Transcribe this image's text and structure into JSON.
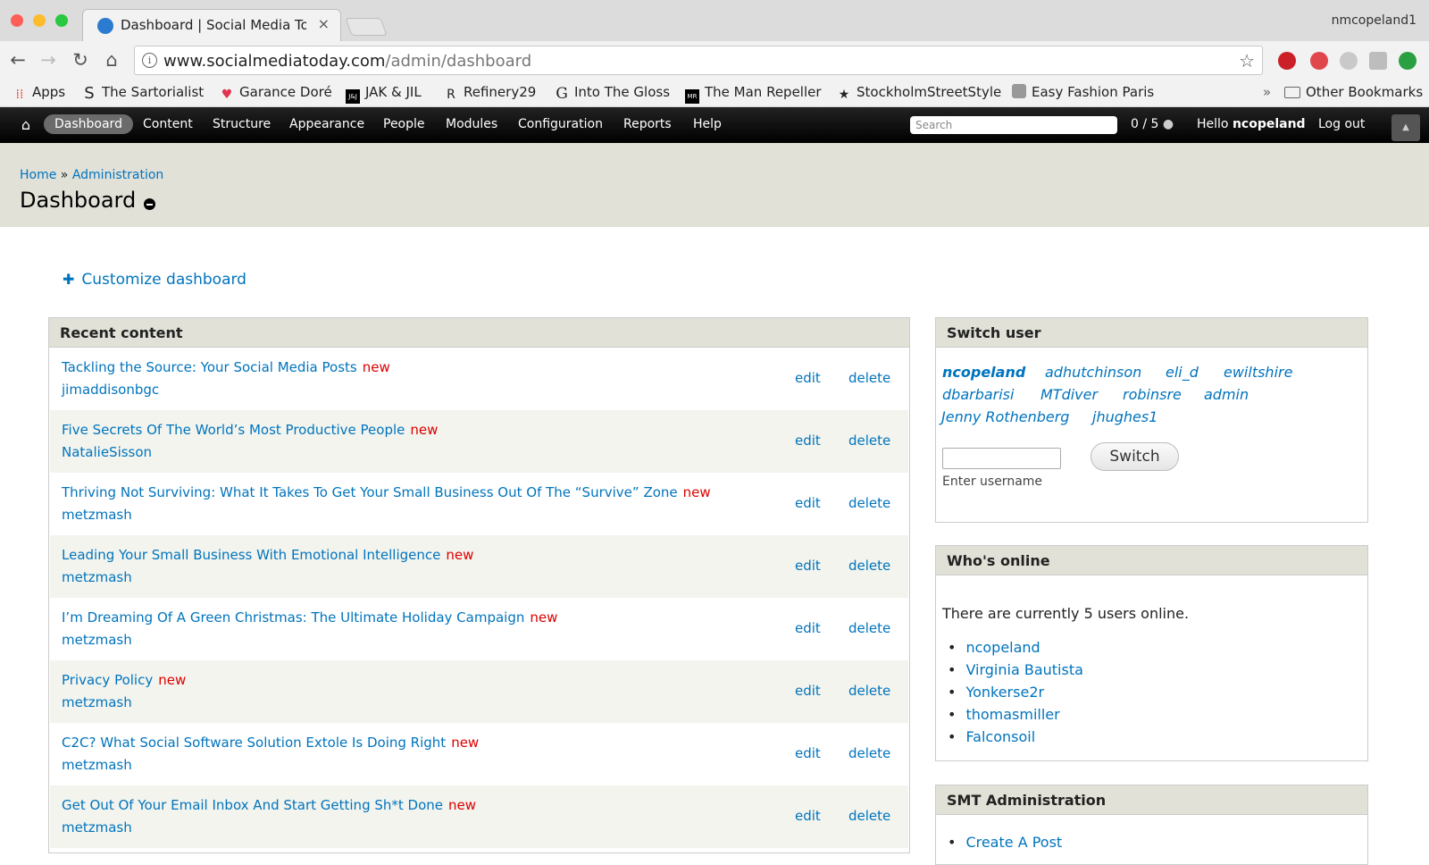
{
  "browser": {
    "tab_title": "Dashboard | Social Media Today",
    "tab_close": "×",
    "profile_name": "nmcopeland1",
    "url_domain": "www.socialmediatoday.com",
    "url_path": "/admin/dashboard",
    "colors": {
      "close": "#fd5f57",
      "minimize": "#fdbc2e",
      "maximize": "#28c840"
    }
  },
  "bookmarks": {
    "items": [
      {
        "label": "Apps",
        "icon": "apps-grid-icon"
      },
      {
        "label": "The Sartorialist",
        "icon": "sartorialist-s-icon"
      },
      {
        "label": "Garance Doré",
        "icon": "heart-icon"
      },
      {
        "label": "JAK & JIL",
        "icon": "jakjil-icon"
      },
      {
        "label": "Refinery29",
        "icon": "refinery29-icon"
      },
      {
        "label": "Into The Gloss",
        "icon": "gloss-g-icon"
      },
      {
        "label": "The Man Repeller",
        "icon": "man-repeller-icon"
      },
      {
        "label": "StockholmStreetStyle",
        "icon": "star-icon"
      },
      {
        "label": "Easy Fashion Paris",
        "icon": "camera-icon"
      }
    ],
    "overflow": "»",
    "other": "Other Bookmarks"
  },
  "admin_bar": {
    "menu": [
      "Dashboard",
      "Content",
      "Structure",
      "Appearance",
      "People",
      "Modules",
      "Configuration",
      "Reports",
      "Help"
    ],
    "search_placeholder": "Search",
    "counter": "0 / 5",
    "greeting_prefix": "Hello ",
    "greeting_user": "ncopeland",
    "logout": "Log out"
  },
  "header": {
    "breadcrumb_home": "Home",
    "breadcrumb_sep": "»",
    "breadcrumb_admin": "Administration",
    "title": "Dashboard"
  },
  "customize": {
    "plus": "✚",
    "label": "Customize dashboard"
  },
  "recent": {
    "title": "Recent content",
    "new_label": "new",
    "edit_label": "edit",
    "delete_label": "delete",
    "rows": [
      {
        "title": "Tackling the Source: Your Social Media Posts",
        "author": "jimaddisonbgc"
      },
      {
        "title": "Five Secrets Of The World’s Most Productive People",
        "author": "NatalieSisson"
      },
      {
        "title": "Thriving Not Surviving: What It Takes To Get Your Small Business Out Of The “Survive” Zone",
        "author": "metzmash"
      },
      {
        "title": "Leading Your Small Business With Emotional Intelligence",
        "author": "metzmash"
      },
      {
        "title": "I’m Dreaming Of A Green Christmas: The Ultimate Holiday Campaign",
        "author": "metzmash"
      },
      {
        "title": "Privacy Policy",
        "author": "metzmash"
      },
      {
        "title": "C2C? What Social Software Solution Extole Is Doing Right",
        "author": "metzmash"
      },
      {
        "title": "Get Out Of Your Email Inbox And Start Getting Sh*t Done",
        "author": "metzmash"
      }
    ]
  },
  "switch_user": {
    "title": "Switch user",
    "users": [
      "ncopeland",
      "adhutchinson",
      "eli_d",
      "ewiltshire",
      "dbarbarisi",
      "MTdiver",
      "robinsre",
      "admin",
      "Jenny Rothenberg",
      "jhughes1"
    ],
    "input_value": "",
    "hint": "Enter username",
    "button": "Switch"
  },
  "whos_online": {
    "title": "Who's online",
    "summary": "There are currently 5 users online.",
    "users": [
      "ncopeland",
      "Virginia Bautista",
      "Yonkerse2r",
      "thomasmiller",
      "Falconsoil"
    ]
  },
  "smt_admin": {
    "title": "SMT Administration",
    "items": [
      "Create A Post"
    ]
  }
}
